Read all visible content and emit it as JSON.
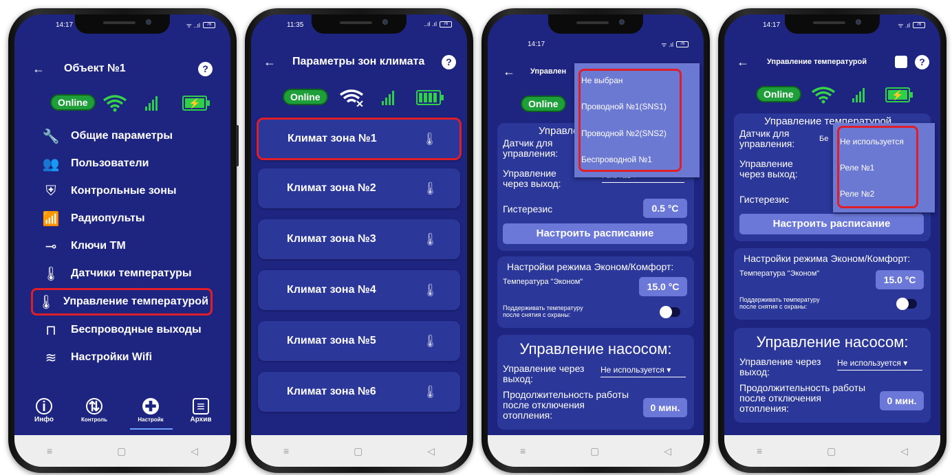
{
  "status": {
    "online_label": "Online",
    "battery_pct": "76"
  },
  "phone1": {
    "time": "14:17",
    "title": "Объект №1",
    "help": "?",
    "menu": [
      {
        "icon": "wrench-icon",
        "label": "Общие параметры"
      },
      {
        "icon": "users-icon",
        "label": "Пользователи"
      },
      {
        "icon": "shield-icon",
        "label": "Контрольные зоны"
      },
      {
        "icon": "remote-icon",
        "label": "Радиопульты"
      },
      {
        "icon": "key-icon",
        "label": "Ключи ТМ"
      },
      {
        "icon": "thermometer-icon",
        "label": "Датчики температуры"
      },
      {
        "icon": "thermostat-icon",
        "label": "Управление температурой"
      },
      {
        "icon": "wireless-output-icon",
        "label": "Беспроводные выходы"
      },
      {
        "icon": "wifi-icon",
        "label": "Настройки Wifi"
      }
    ],
    "nav": [
      {
        "icon": "info-icon",
        "label": "Инфо"
      },
      {
        "icon": "control-icon",
        "label": "Контроль"
      },
      {
        "icon": "settings-icon",
        "label": "Настройк"
      },
      {
        "icon": "calendar-icon",
        "label": "Архив"
      }
    ]
  },
  "phone2": {
    "time": "11:35",
    "title": "Параметры зон климата",
    "help": "?",
    "zones": [
      "Климат зона №1",
      "Климат зона №2",
      "Климат зона №3",
      "Климат зона №4",
      "Климат зона №5",
      "Климат зона №6"
    ]
  },
  "phone3": {
    "time": "14:17",
    "title": "Управлен",
    "sensor_label": "Датчик для управления:",
    "output_label": "Управление через выход:",
    "output_value": "Реле №1",
    "hysteresis_label": "Гистерезис",
    "hysteresis_value": "0.5 °C",
    "schedule_button": "Настроить расписание",
    "card_title": "Управле",
    "eco_title": "Настройки режима Эконом/Комфорт:",
    "eco_temp_label": "Температура \"Эконом\"",
    "eco_temp_value": "15.0 °C",
    "keep_temp_label": "Поддерживать температуру после снятия с охраны:",
    "pump_title": "Управление насосом:",
    "pump_output_label": "Управление через выход:",
    "pump_output_value": "Не используется",
    "duration_label": "Продолжительность работы после отключения отопления:",
    "duration_value": "0 мин.",
    "popup_options": [
      "Не выбран",
      "Проводной №1(SNS1)",
      "Проводной №2(SNS2)",
      "Беспроводной №1"
    ]
  },
  "phone4": {
    "time": "14:17",
    "title": "Управление температурой",
    "card_title": "Управление температурой",
    "sensor_label": "Датчик для управления:",
    "sensor_value": "Бе",
    "output_label": "Управление через выход:",
    "hysteresis_label": "Гистерезис",
    "schedule_button": "Настроить расписание",
    "eco_title": "Настройки режима Эконом/Комфорт:",
    "eco_temp_label": "Температура \"Эконом\"",
    "eco_temp_value": "15.0 °C",
    "keep_temp_label": "Поддерживать температуру после снятия с охраны:",
    "pump_title": "Управление насосом:",
    "pump_output_label": "Управление через выход:",
    "pump_output_value": "Не используется",
    "duration_label": "Продолжительность работы после отключения отопления:",
    "duration_value": "0 мин.",
    "popup_options": [
      "Не используется",
      "Реле №1",
      "Реле №2"
    ]
  },
  "colors": {
    "bg": "#1e2580",
    "card": "#2b3799",
    "accent_green": "#2fd048",
    "highlight_red": "#e01e2a",
    "button": "#6b78d8"
  }
}
